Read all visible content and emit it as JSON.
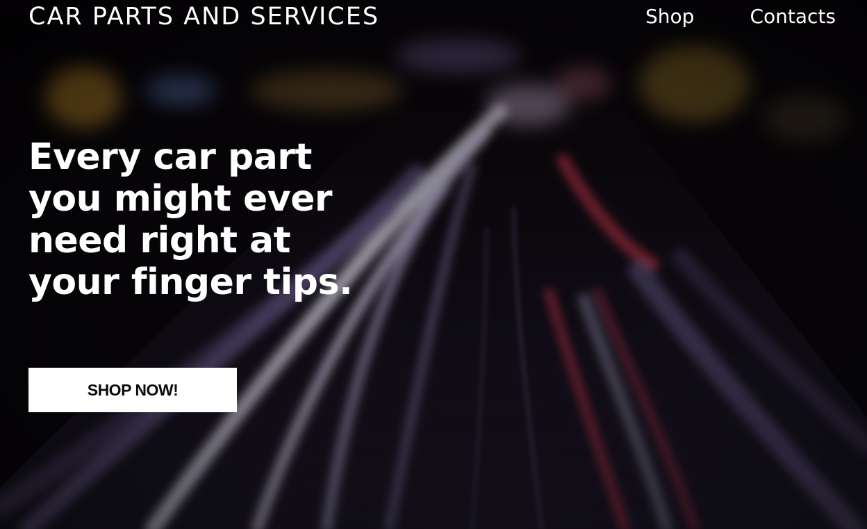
{
  "header": {
    "brand": "CAR PARTS AND SERVICES",
    "nav": [
      {
        "label": "Shop"
      },
      {
        "label": "Contacts"
      }
    ]
  },
  "hero": {
    "headline_lines": [
      "Every car part",
      "you might ever",
      "need right at",
      "your finger tips."
    ],
    "cta_label": "SHOP NOW!",
    "background": {
      "subject": "blurred night highway with light trails",
      "colors": {
        "base": "#050305",
        "trail_white": "#e8e4f4",
        "trail_violet": "#8a7cb8",
        "trail_red": "#c8344c",
        "glow_amber": "#c8902a",
        "glow_blue": "#6a8cd8"
      }
    },
    "text_color": "#ffffff",
    "button_bg": "#ffffff",
    "button_text_color": "#0b0b0b"
  }
}
